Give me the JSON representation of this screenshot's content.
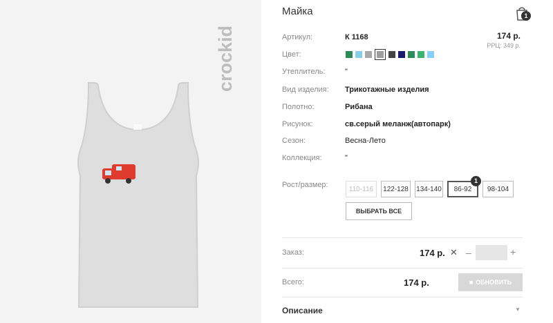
{
  "product": {
    "title": "Майка",
    "brand": "crockid",
    "cart_count": "1",
    "price": "174 р.",
    "rrp": "РРЦ: 349 р."
  },
  "details": {
    "article_label": "Артикул:",
    "article_value": "К 1168",
    "color_label": "Цвет:",
    "insulation_label": "Утеплитель:",
    "insulation_value": "\"",
    "type_label": "Вид изделия:",
    "type_value": "Трикотажные изделия",
    "fabric_label": "Полотно:",
    "fabric_value": "Рибана",
    "pattern_label": "Рисунок:",
    "pattern_value": "св.серый меланж(автопарк)",
    "season_label": "Сезон:",
    "season_value": "Весна-Лето",
    "collection_label": "Коллекция:",
    "collection_value": "\"",
    "size_label": "Рост/размер:"
  },
  "swatches": [
    "#2e8b57",
    "#87ceeb",
    "#a9a9a9",
    "#9e9e9e",
    "#444444",
    "#1a1a6e",
    "#2e8b57",
    "#3cb371",
    "#87cefa"
  ],
  "sizes": [
    {
      "label": "110-116",
      "state": "disabled"
    },
    {
      "label": "122-128",
      "state": "normal"
    },
    {
      "label": "134-140",
      "state": "normal"
    },
    {
      "label": "86-92",
      "state": "active",
      "badge": "1"
    },
    {
      "label": "98-104",
      "state": "normal"
    }
  ],
  "actions": {
    "select_all": "ВЫБРАТЬ ВСЕ",
    "order_label": "Заказ:",
    "order_price": "174 р.",
    "multiply": "✕",
    "minus": "–",
    "plus": "+",
    "total_label": "Всего:",
    "total_price": "174 р.",
    "update": "ОБНОВИТЬ",
    "description": "Описание",
    "description_arrow": "▼"
  }
}
